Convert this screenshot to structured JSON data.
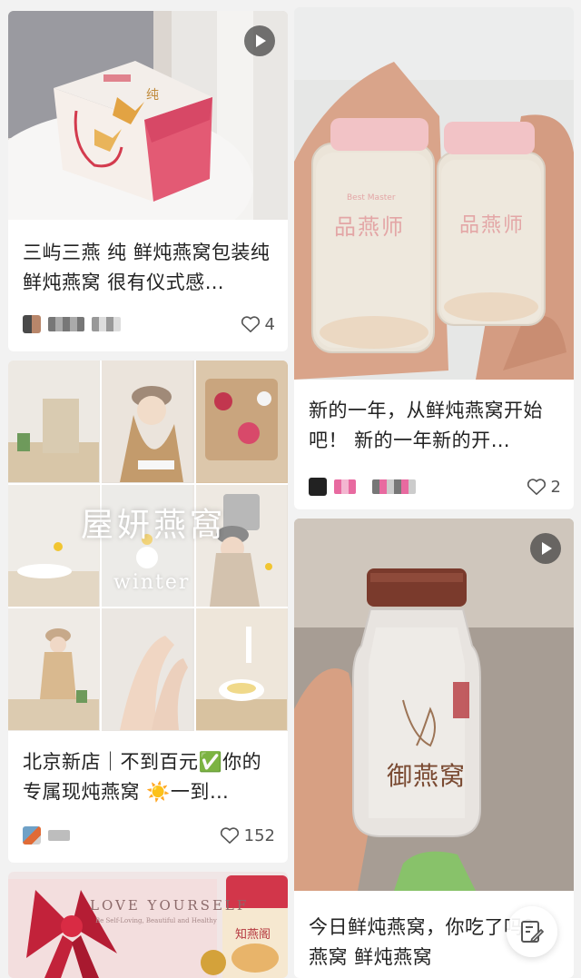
{
  "cards": {
    "c1": {
      "title": "三屿三燕 纯 鲜炖燕窝包装纯 鲜炖燕窝 很有仪式感…",
      "likes": "4",
      "bag_char": "纯"
    },
    "c2": {
      "title": "新的一年，从鲜炖燕窝开始吧！ 新的一年新的开…",
      "likes": "2",
      "jar_brand": "品燕师",
      "jar_brand_en": "Best Master"
    },
    "c3": {
      "title": "北京新店｜不到百元✅你的专属现炖燕窝 ☀️一到…",
      "likes": "152",
      "overlay_text": "屋妍燕窩",
      "overlay_sub": "winter"
    },
    "c4": {
      "title": "今日鲜炖燕窝，你吃了吗？ 燕窝 鲜炖燕窝",
      "jar_brand": "御燕窝"
    },
    "c5": {
      "box_text": "LOVE YOURSELF",
      "box_sub": "Be Self-Loving, Beautiful and Healthy",
      "jar_brand": "知燕阁"
    }
  },
  "icons": {
    "like": "heart-outline-icon",
    "play": "play-icon",
    "edit": "edit-note-icon"
  },
  "colors": {
    "background": "#f2f2f2",
    "card": "#ffffff",
    "text": "#222222",
    "accent": "#c83a4a"
  }
}
